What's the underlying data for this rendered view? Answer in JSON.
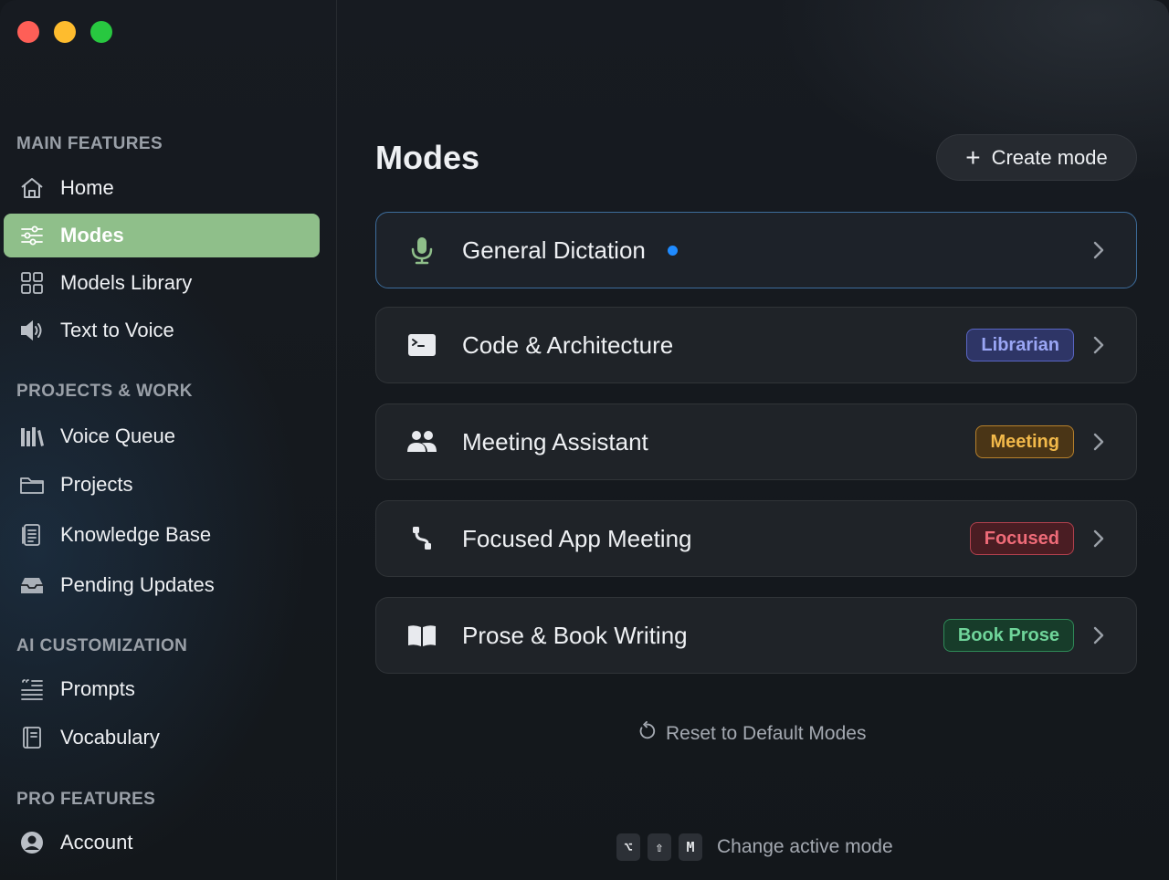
{
  "sidebar": {
    "sections": {
      "main": "MAIN FEATURES",
      "projects": "PROJECTS & WORK",
      "ai": "AI CUSTOMIZATION",
      "pro": "PRO FEATURES"
    },
    "items": {
      "home": "Home",
      "modes": "Modes",
      "models_library": "Models Library",
      "text_to_voice": "Text to Voice",
      "voice_queue": "Voice Queue",
      "projects": "Projects",
      "knowledge_base": "Knowledge Base",
      "pending_updates": "Pending Updates",
      "prompts": "Prompts",
      "vocabulary": "Vocabulary",
      "account": "Account"
    },
    "active_item": "Modes"
  },
  "main": {
    "title": "Modes",
    "create_button": "Create mode",
    "modes": [
      {
        "name": "General Dictation",
        "icon": "microphone-icon",
        "active": true,
        "badge": ""
      },
      {
        "name": "Code & Architecture",
        "icon": "terminal-icon",
        "active": false,
        "badge": "Librarian"
      },
      {
        "name": "Meeting Assistant",
        "icon": "people-icon",
        "active": false,
        "badge": "Meeting"
      },
      {
        "name": "Focused App Meeting",
        "icon": "path-icon",
        "active": false,
        "badge": "Focused"
      },
      {
        "name": "Prose & Book Writing",
        "icon": "book-icon",
        "active": false,
        "badge": "Book Prose"
      }
    ],
    "reset_label": "Reset to Default Modes",
    "shortcut": {
      "keys": [
        "⌥",
        "⇧",
        "M"
      ],
      "label": "Change active mode"
    }
  },
  "colors": {
    "accent_active_nav": "#8fbf8a",
    "active_dot": "#1f8bff",
    "badge_librarian": "#9aa6f5",
    "badge_meeting": "#f2b94a",
    "badge_focused": "#ef6b78",
    "badge_book_prose": "#6fd49a"
  }
}
